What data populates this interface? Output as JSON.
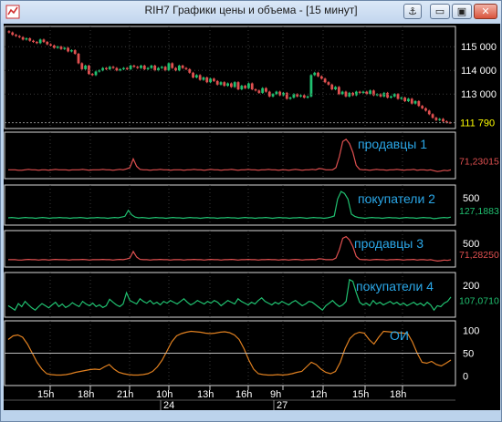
{
  "window": {
    "title": "RIH7 Графики цены и объема - [15 минут]",
    "buttons": {
      "pin": "⚓",
      "minimize": "▭",
      "maximize": "▣",
      "close": "✕"
    }
  },
  "colors": {
    "background": "#000000",
    "bull": "#20c070",
    "bear": "#e05050",
    "sellers_line": "#e05050",
    "buyers_line": "#20c070",
    "oi_line": "#e08020",
    "label_text": "#2aa7e8",
    "last_price_bg": "#ffff00",
    "value_badge_red": "#e05050",
    "value_badge_green": "#20c070"
  },
  "chart_data": [
    {
      "type": "candlestick",
      "title": "",
      "ylim": [
        111700,
        115700
      ],
      "y_ticks": [
        "115 000",
        "114 000",
        "113 000"
      ],
      "last_price": "111 790",
      "closes": [
        115600,
        115500,
        115450,
        115400,
        115300,
        115350,
        115250,
        115200,
        115150,
        115300,
        115200,
        115100,
        115050,
        114950,
        115000,
        114900,
        114950,
        114800,
        114850,
        114700,
        114300,
        114050,
        114200,
        113850,
        113800,
        113950,
        114000,
        114100,
        114050,
        114150,
        114100,
        114000,
        114050,
        114100,
        114050,
        114200,
        114150,
        114100,
        114200,
        114050,
        114100,
        114200,
        114000,
        114100,
        114150,
        114000,
        114300,
        114100,
        114000,
        114200,
        114100,
        114050,
        113900,
        113700,
        113800,
        113600,
        113700,
        113500,
        113650,
        113550,
        113400,
        113500,
        113350,
        113450,
        113300,
        113500,
        113200,
        113350,
        113250,
        113450,
        113200,
        113150,
        113050,
        113250,
        113100,
        112900,
        113000,
        113100,
        112950,
        113050,
        112800,
        112850,
        113000,
        112900,
        112950,
        112850,
        112900,
        113800,
        113900,
        113750,
        113650,
        113500,
        113400,
        113200,
        113300,
        113000,
        113100,
        112900,
        113050,
        112950,
        113100,
        113050,
        113100,
        113000,
        113150,
        112950,
        113000,
        112900,
        113050,
        112850,
        112900,
        113000,
        112800,
        112850,
        112700,
        112800,
        112600,
        112700,
        112500,
        112400,
        112300,
        112150,
        112000,
        111900,
        111950,
        111850,
        111800,
        111790
      ]
    },
    {
      "type": "line",
      "title": "",
      "label": "продавцы 1",
      "value_badge": "71,23015",
      "y_ticks": [],
      "values": [
        30,
        30,
        30,
        29,
        29,
        30,
        31,
        30,
        30,
        29,
        30,
        30,
        29,
        30,
        31,
        30,
        30,
        30,
        29,
        30,
        30,
        30,
        31,
        30,
        29,
        30,
        30,
        30,
        31,
        30,
        30,
        29,
        30,
        31,
        30,
        32,
        35,
        55,
        38,
        31,
        30,
        30,
        29,
        30,
        30,
        31,
        30,
        30,
        29,
        30,
        30,
        30,
        29,
        30,
        30,
        31,
        30,
        30,
        29,
        30,
        31,
        30,
        30,
        29,
        30,
        30,
        31,
        30,
        29,
        30,
        30,
        31,
        30,
        30,
        29,
        30,
        30,
        31,
        30,
        30,
        29,
        30,
        30,
        29,
        30,
        31,
        30,
        29,
        30,
        30,
        31,
        30,
        33,
        32,
        30,
        30,
        30,
        35,
        60,
        95,
        100,
        90,
        70,
        40,
        31,
        30,
        30,
        29,
        30,
        31,
        30,
        30,
        29,
        30,
        30,
        31,
        30,
        29,
        30,
        30,
        31,
        29,
        30,
        30,
        29,
        30,
        28,
        26,
        27,
        29,
        28,
        30
      ]
    },
    {
      "type": "line",
      "title": "",
      "label": "покупатели 2",
      "value_badge": "127,1883",
      "y_ticks": [
        "500"
      ],
      "values": [
        30,
        31,
        30,
        29,
        30,
        31,
        30,
        30,
        29,
        30,
        31,
        30,
        29,
        30,
        30,
        31,
        30,
        30,
        29,
        30,
        30,
        31,
        30,
        29,
        30,
        30,
        31,
        30,
        30,
        29,
        30,
        31,
        30,
        32,
        34,
        50,
        38,
        32,
        30,
        31,
        30,
        29,
        30,
        31,
        30,
        30,
        29,
        30,
        31,
        30,
        30,
        29,
        30,
        31,
        30,
        30,
        29,
        30,
        31,
        30,
        30,
        29,
        30,
        30,
        31,
        30,
        30,
        29,
        30,
        31,
        30,
        30,
        29,
        30,
        30,
        31,
        30,
        29,
        30,
        31,
        30,
        30,
        29,
        30,
        30,
        31,
        30,
        29,
        30,
        31,
        30,
        30,
        29,
        30,
        32,
        35,
        80,
        100,
        95,
        80,
        40,
        34,
        31,
        30,
        29,
        30,
        31,
        30,
        30,
        29,
        30,
        31,
        30,
        30,
        29,
        30,
        31,
        30,
        30,
        29,
        30,
        31,
        30,
        30,
        28,
        29,
        30,
        31,
        30,
        32
      ]
    },
    {
      "type": "line",
      "title": "",
      "label": "продавцы 3",
      "value_badge": "71,28250",
      "y_ticks": [
        "500"
      ],
      "values": [
        30,
        30,
        30,
        29,
        29,
        30,
        31,
        30,
        30,
        29,
        30,
        30,
        29,
        30,
        31,
        30,
        30,
        30,
        29,
        30,
        30,
        30,
        31,
        30,
        29,
        30,
        30,
        30,
        31,
        30,
        30,
        29,
        30,
        31,
        30,
        32,
        35,
        55,
        38,
        31,
        30,
        30,
        29,
        30,
        30,
        31,
        30,
        30,
        29,
        30,
        30,
        30,
        29,
        30,
        30,
        31,
        30,
        30,
        29,
        30,
        31,
        30,
        30,
        29,
        30,
        30,
        31,
        30,
        29,
        30,
        30,
        31,
        30,
        30,
        29,
        30,
        30,
        31,
        30,
        30,
        29,
        30,
        30,
        29,
        30,
        31,
        30,
        29,
        30,
        30,
        31,
        30,
        33,
        32,
        30,
        30,
        30,
        35,
        60,
        95,
        100,
        90,
        70,
        40,
        31,
        30,
        30,
        29,
        30,
        31,
        30,
        30,
        29,
        30,
        30,
        31,
        30,
        29,
        30,
        30,
        31,
        29,
        30,
        30,
        29,
        30,
        28,
        26,
        27,
        29,
        28,
        30
      ]
    },
    {
      "type": "line",
      "title": "",
      "label": "покупатели 4",
      "value_badge": "107,0710",
      "y_ticks": [
        "200"
      ],
      "values": [
        40,
        35,
        30,
        45,
        38,
        50,
        42,
        35,
        30,
        38,
        45,
        40,
        35,
        42,
        48,
        38,
        44,
        36,
        40,
        47,
        42,
        38,
        50,
        44,
        40,
        46,
        38,
        42,
        36,
        40,
        55,
        48,
        42,
        38,
        44,
        70,
        52,
        48,
        44,
        56,
        50,
        46,
        52,
        44,
        48,
        42,
        50,
        46,
        52,
        48,
        44,
        50,
        56,
        48,
        42,
        46,
        52,
        48,
        44,
        50,
        46,
        52,
        48,
        40,
        46,
        52,
        48,
        44,
        56,
        50,
        46,
        42,
        48,
        44,
        52,
        58,
        50,
        46,
        42,
        48,
        44,
        50,
        46,
        42,
        48,
        52,
        46,
        40,
        44,
        50,
        48,
        42,
        36,
        30,
        40,
        46,
        52,
        44,
        38,
        42,
        50,
        100,
        96,
        70,
        48,
        42,
        46,
        40,
        52,
        44,
        48,
        42,
        46,
        50,
        44,
        48,
        42,
        46,
        40,
        44,
        48,
        42,
        46,
        40,
        48,
        42,
        30,
        40,
        38,
        46,
        50,
        60
      ]
    },
    {
      "type": "line",
      "title": "",
      "label": "ОИ",
      "y_ticks": [
        "100",
        "50",
        "0"
      ],
      "ylim": [
        -15,
        115
      ],
      "values": [
        80,
        88,
        90,
        85,
        70,
        50,
        30,
        15,
        5,
        3,
        2,
        2,
        3,
        5,
        8,
        10,
        12,
        14,
        15,
        14,
        20,
        25,
        15,
        8,
        5,
        3,
        2,
        2,
        3,
        5,
        10,
        20,
        35,
        55,
        75,
        88,
        93,
        96,
        98,
        97,
        96,
        94,
        93,
        94,
        96,
        97,
        95,
        90,
        80,
        60,
        35,
        15,
        5,
        3,
        2,
        2,
        3,
        2,
        3,
        5,
        8,
        10,
        20,
        30,
        25,
        15,
        8,
        5,
        10,
        30,
        60,
        82,
        92,
        96,
        94,
        80,
        70,
        85,
        98,
        97,
        96,
        95,
        94,
        93,
        75,
        50,
        30,
        28,
        32,
        25,
        22,
        28,
        35
      ]
    }
  ],
  "x_axis": {
    "ticks": [
      "15h",
      "18h",
      "21h",
      "10h",
      "13h",
      "16h",
      "9h",
      "12h",
      "15h",
      "18h"
    ],
    "dates": [
      "24",
      "27"
    ]
  }
}
